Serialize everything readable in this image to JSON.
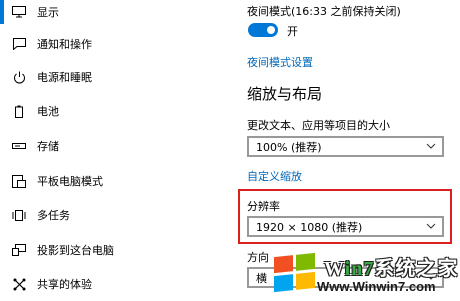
{
  "sidebar": {
    "items": [
      {
        "label": "显示",
        "icon": "display-icon",
        "active": true
      },
      {
        "label": "通知和操作",
        "icon": "notification-icon",
        "active": false
      },
      {
        "label": "电源和睡眠",
        "icon": "power-icon",
        "active": false
      },
      {
        "label": "电池",
        "icon": "battery-icon",
        "active": false
      },
      {
        "label": "存储",
        "icon": "storage-icon",
        "active": false
      },
      {
        "label": "平板电脑模式",
        "icon": "tablet-mode-icon",
        "active": false
      },
      {
        "label": "多任务",
        "icon": "multitasking-icon",
        "active": false
      },
      {
        "label": "投影到这台电脑",
        "icon": "project-icon",
        "active": false
      },
      {
        "label": "共享的体验",
        "icon": "shared-experience-icon",
        "active": false
      }
    ]
  },
  "main": {
    "night_light_label": "夜间模式(16:33 之前保持关闭)",
    "night_light_toggle": "开",
    "night_light_settings_link": "夜间模式设置",
    "scale_heading": "缩放与布局",
    "scale_label": "更改文本、应用等项目的大小",
    "scale_value": "100% (推荐)",
    "custom_scaling_link": "自定义缩放",
    "resolution_label": "分辨率",
    "resolution_value": "1920 × 1080 (推荐)",
    "orientation_label": "方向",
    "orientation_value": "横"
  },
  "watermark": {
    "brand_prefix": "W",
    "brand_highlight": "in7",
    "brand_suffix": "系统之家",
    "url": "Www.Winwin7.com"
  },
  "colors": {
    "accent": "#0078d7",
    "link": "#0067b8",
    "highlight_border": "#d9201d"
  }
}
